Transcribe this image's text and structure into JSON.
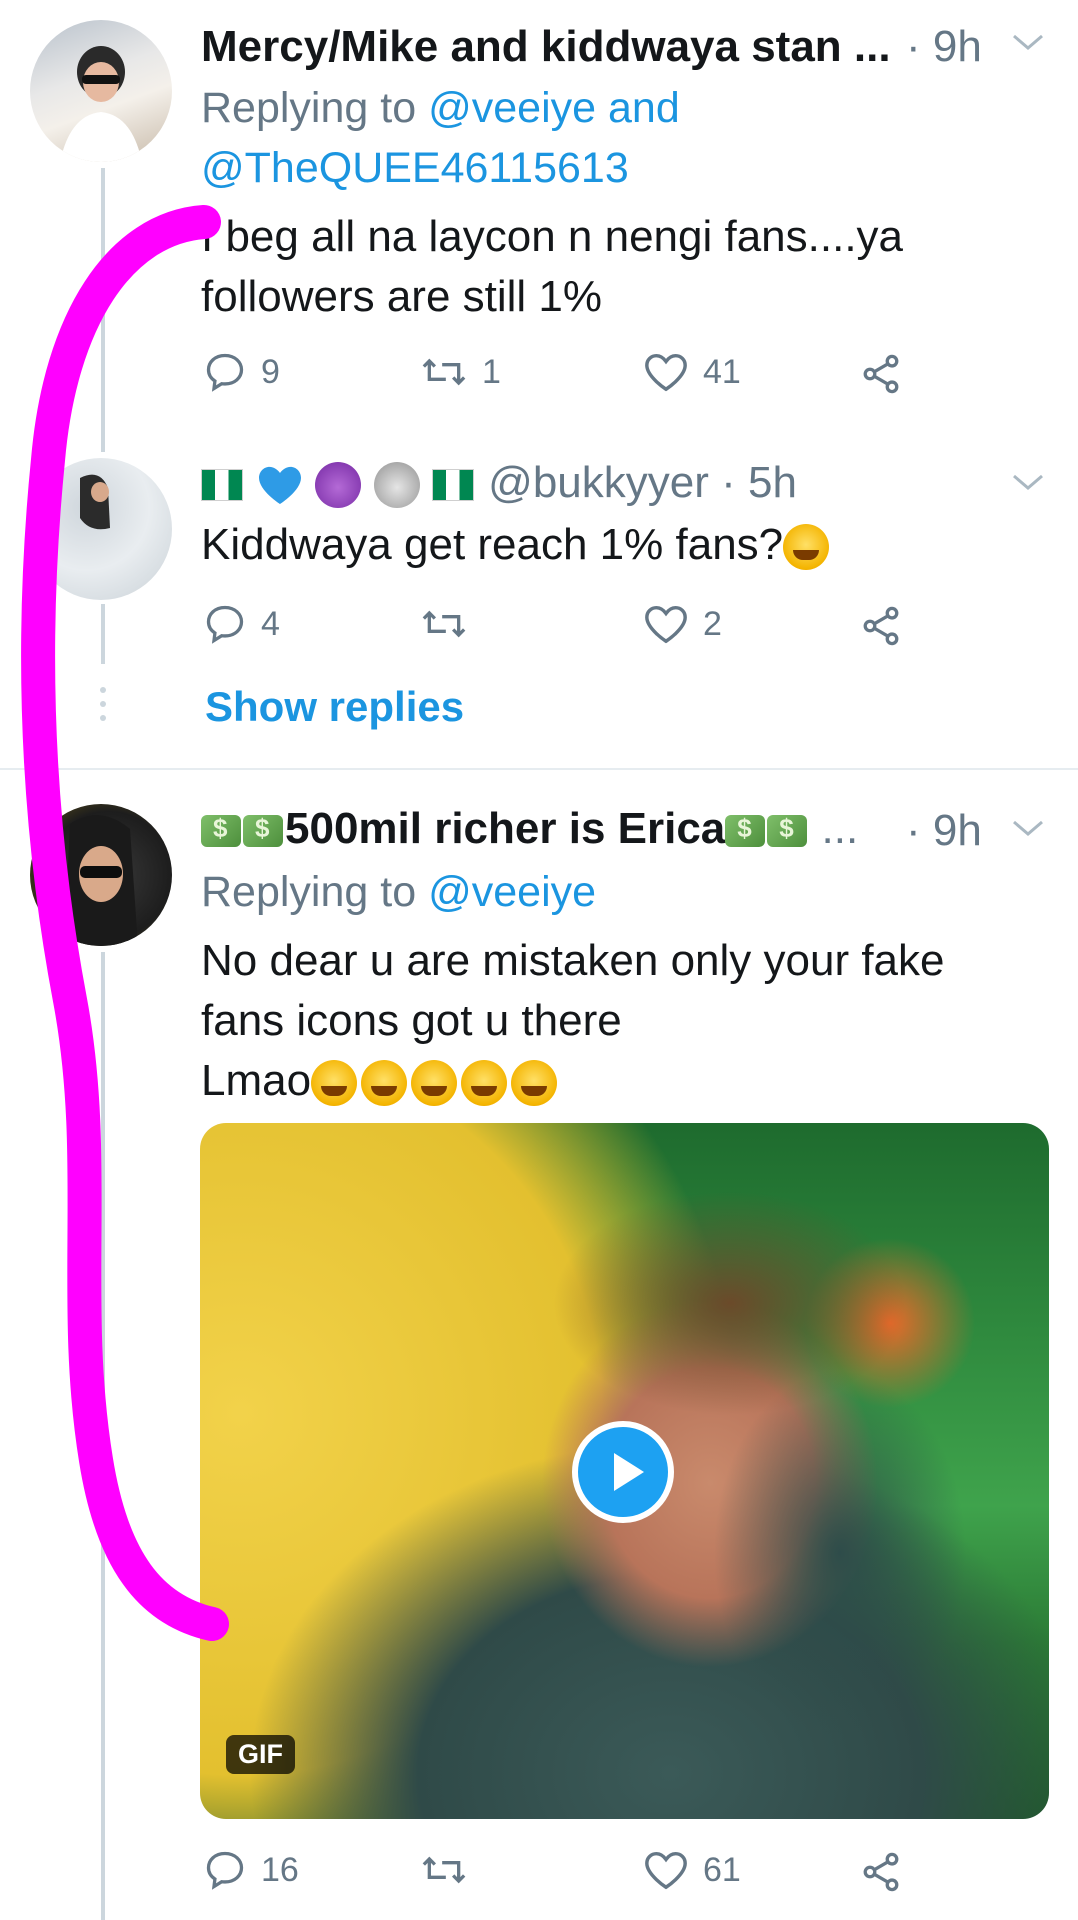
{
  "tweets": [
    {
      "author": "Mercy/Mike and kiddwaya stan ...",
      "time": "· 9h",
      "replying_prefix": "Replying to",
      "replying_handles": "@veeiye and",
      "replying_handles_2": "@TheQUEE46115613",
      "text_lines": [
        "I beg all na laycon n nengi fans....ya",
        "followers are still 1%"
      ],
      "replies": "9",
      "retweets": "1",
      "likes": "41"
    },
    {
      "handle": "@bukkyyer",
      "time": "· 5h",
      "text": "Kiddwaya get reach 1% fans?",
      "replies": "4",
      "retweets": "",
      "likes": "2",
      "show_replies": "Show replies"
    },
    {
      "author": "500mil richer is Erica",
      "author_suffix": "...",
      "time": "· 9h",
      "replying_prefix": "Replying to",
      "replying_handles": "@veeiye",
      "text_lines": [
        "No dear u are mistaken only your fake",
        "fans icons got u there",
        "Lmao"
      ],
      "media_badge": "GIF",
      "replies": "16",
      "retweets": "",
      "likes": "61"
    }
  ],
  "icons": {
    "reply": "reply-icon",
    "retweet": "retweet-icon",
    "like": "heart-icon",
    "share": "share-icon",
    "more": "chevron-down-icon"
  },
  "colors": {
    "link": "#1b95e0",
    "muted": "#657786",
    "annotation": "#ff00ff"
  }
}
